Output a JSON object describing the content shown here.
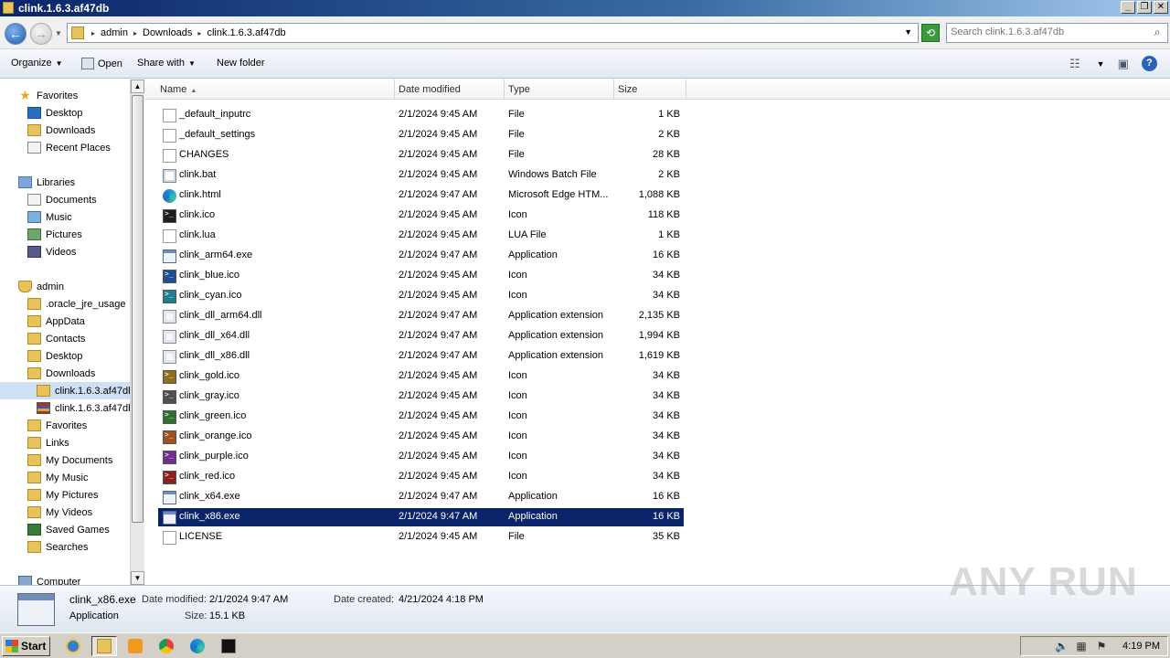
{
  "window": {
    "title": "clink.1.6.3.af47db"
  },
  "address": {
    "crumbs": [
      "admin",
      "Downloads",
      "clink.1.6.3.af47db"
    ],
    "search_placeholder": "Search clink.1.6.3.af47db"
  },
  "toolbar": {
    "organize": "Organize",
    "open": "Open",
    "share_with": "Share with",
    "new_folder": "New folder"
  },
  "nav": {
    "items": [
      {
        "label": "Favorites",
        "icon": "star-icon"
      },
      {
        "label": "Desktop",
        "icon": "desktop-icon"
      },
      {
        "label": "Downloads",
        "icon": "folder-icon"
      },
      {
        "label": "Recent Places",
        "icon": "recent-places-icon"
      },
      {
        "label": "Libraries",
        "icon": "libraries-icon"
      },
      {
        "label": "Documents",
        "icon": "documents-icon"
      },
      {
        "label": "Music",
        "icon": "music-icon"
      },
      {
        "label": "Pictures",
        "icon": "pictures-icon"
      },
      {
        "label": "Videos",
        "icon": "videos-icon"
      },
      {
        "label": "admin",
        "icon": "user-folder-icon"
      },
      {
        "label": ".oracle_jre_usage",
        "icon": "folder-icon"
      },
      {
        "label": "AppData",
        "icon": "folder-icon"
      },
      {
        "label": "Contacts",
        "icon": "folder-icon"
      },
      {
        "label": "Desktop",
        "icon": "folder-icon"
      },
      {
        "label": "Downloads",
        "icon": "folder-icon"
      },
      {
        "label": "clink.1.6.3.af47db",
        "icon": "folder-icon"
      },
      {
        "label": "clink.1.6.3.af47db",
        "icon": "archive-icon"
      },
      {
        "label": "Favorites",
        "icon": "folder-icon"
      },
      {
        "label": "Links",
        "icon": "folder-icon"
      },
      {
        "label": "My Documents",
        "icon": "folder-icon"
      },
      {
        "label": "My Music",
        "icon": "folder-icon"
      },
      {
        "label": "My Pictures",
        "icon": "folder-icon"
      },
      {
        "label": "My Videos",
        "icon": "folder-icon"
      },
      {
        "label": "Saved Games",
        "icon": "saved-games-icon"
      },
      {
        "label": "Searches",
        "icon": "searches-icon"
      },
      {
        "label": "Computer",
        "icon": "computer-icon"
      }
    ]
  },
  "columns": {
    "name": "Name",
    "date": "Date modified",
    "type": "Type",
    "size": "Size"
  },
  "files": [
    {
      "name": "_default_inputrc",
      "date": "2/1/2024 9:45 AM",
      "type": "File",
      "size": "1 KB",
      "icon": "file"
    },
    {
      "name": "_default_settings",
      "date": "2/1/2024 9:45 AM",
      "type": "File",
      "size": "2 KB",
      "icon": "file"
    },
    {
      "name": "CHANGES",
      "date": "2/1/2024 9:45 AM",
      "type": "File",
      "size": "28 KB",
      "icon": "file"
    },
    {
      "name": "clink.bat",
      "date": "2/1/2024 9:45 AM",
      "type": "Windows Batch File",
      "size": "2 KB",
      "icon": "bat"
    },
    {
      "name": "clink.html",
      "date": "2/1/2024 9:47 AM",
      "type": "Microsoft Edge HTM...",
      "size": "1,088 KB",
      "icon": "edge"
    },
    {
      "name": "clink.ico",
      "date": "2/1/2024 9:45 AM",
      "type": "Icon",
      "size": "118 KB",
      "icon": "ico",
      "accent": "#1e1e1e"
    },
    {
      "name": "clink.lua",
      "date": "2/1/2024 9:45 AM",
      "type": "LUA File",
      "size": "1 KB",
      "icon": "file"
    },
    {
      "name": "clink_arm64.exe",
      "date": "2/1/2024 9:47 AM",
      "type": "Application",
      "size": "16 KB",
      "icon": "exe"
    },
    {
      "name": "clink_blue.ico",
      "date": "2/1/2024 9:45 AM",
      "type": "Icon",
      "size": "34 KB",
      "icon": "ico",
      "accent": "#1f4f8f"
    },
    {
      "name": "clink_cyan.ico",
      "date": "2/1/2024 9:45 AM",
      "type": "Icon",
      "size": "34 KB",
      "icon": "ico",
      "accent": "#1f7f8f"
    },
    {
      "name": "clink_dll_arm64.dll",
      "date": "2/1/2024 9:47 AM",
      "type": "Application extension",
      "size": "2,135 KB",
      "icon": "dll"
    },
    {
      "name": "clink_dll_x64.dll",
      "date": "2/1/2024 9:47 AM",
      "type": "Application extension",
      "size": "1,994 KB",
      "icon": "dll"
    },
    {
      "name": "clink_dll_x86.dll",
      "date": "2/1/2024 9:47 AM",
      "type": "Application extension",
      "size": "1,619 KB",
      "icon": "dll"
    },
    {
      "name": "clink_gold.ico",
      "date": "2/1/2024 9:45 AM",
      "type": "Icon",
      "size": "34 KB",
      "icon": "ico",
      "accent": "#8f6f1f"
    },
    {
      "name": "clink_gray.ico",
      "date": "2/1/2024 9:45 AM",
      "type": "Icon",
      "size": "34 KB",
      "icon": "ico",
      "accent": "#4f4f4f"
    },
    {
      "name": "clink_green.ico",
      "date": "2/1/2024 9:45 AM",
      "type": "Icon",
      "size": "34 KB",
      "icon": "ico",
      "accent": "#2f6f2f"
    },
    {
      "name": "clink_orange.ico",
      "date": "2/1/2024 9:45 AM",
      "type": "Icon",
      "size": "34 KB",
      "icon": "ico",
      "accent": "#a0501f"
    },
    {
      "name": "clink_purple.ico",
      "date": "2/1/2024 9:45 AM",
      "type": "Icon",
      "size": "34 KB",
      "icon": "ico",
      "accent": "#6f2f8f"
    },
    {
      "name": "clink_red.ico",
      "date": "2/1/2024 9:45 AM",
      "type": "Icon",
      "size": "34 KB",
      "icon": "ico",
      "accent": "#8f1f1f"
    },
    {
      "name": "clink_x64.exe",
      "date": "2/1/2024 9:47 AM",
      "type": "Application",
      "size": "16 KB",
      "icon": "exe"
    },
    {
      "name": "clink_x86.exe",
      "date": "2/1/2024 9:47 AM",
      "type": "Application",
      "size": "16 KB",
      "icon": "exe",
      "selected": true
    },
    {
      "name": "LICENSE",
      "date": "2/1/2024 9:45 AM",
      "type": "File",
      "size": "35 KB",
      "icon": "file"
    }
  ],
  "details": {
    "name": "clink_x86.exe",
    "type": "Application",
    "date_modified_label": "Date modified:",
    "date_modified": "2/1/2024 9:47 AM",
    "date_created_label": "Date created:",
    "date_created": "4/21/2024 4:18 PM",
    "size_label": "Size:",
    "size": "15.1 KB"
  },
  "watermark": "ANY RUN",
  "taskbar": {
    "start": "Start",
    "clock": "4:19 PM"
  },
  "colors": {
    "selection": "#0a246a",
    "nav_selection": "#cfe0f5"
  }
}
